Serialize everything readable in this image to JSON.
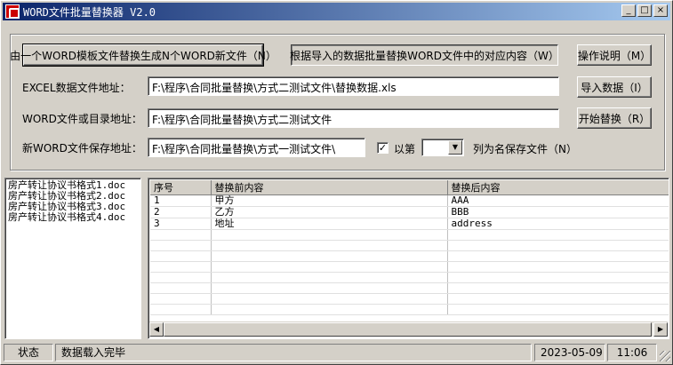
{
  "window": {
    "title": "WORD文件批量替换器 V2.0",
    "min": "_",
    "max": "□",
    "close": "×"
  },
  "buttons": {
    "template_mode": "由一个WORD模板文件替换生成N个WORD新文件（N）",
    "batch_mode": "根据导入的数据批量替换WORD文件中的对应内容（W）",
    "help": "操作说明（M）",
    "import": "导入数据（I）",
    "start": "开始替换（R）"
  },
  "form": {
    "excel_label": "EXCEL数据文件地址：",
    "excel_value": "F:\\程序\\合同批量替换\\方式二测试文件\\替换数据.xls",
    "word_label": "WORD文件或目录地址：",
    "word_value": "F:\\程序\\合同批量替换\\方式二测试文件",
    "save_label": "新WORD文件保存地址：",
    "save_value": "F:\\程序\\合同批量替换\\方式一测试文件\\",
    "checkbox_label": "以第",
    "checkbox_checked": true,
    "column_value": "",
    "column_suffix": "列为名保存文件（N）"
  },
  "files": [
    "房产转让协议书格式1.doc",
    "房产转让协议书格式2.doc",
    "房产转让协议书格式3.doc",
    "房产转让协议书格式4.doc"
  ],
  "grid": {
    "columns": [
      "序号",
      "替换前内容",
      "替换后内容"
    ],
    "rows": [
      [
        "1",
        "甲方",
        "AAA"
      ],
      [
        "2",
        "乙方",
        "BBB"
      ],
      [
        "3",
        "地址",
        "address"
      ]
    ]
  },
  "status": {
    "label": "状态",
    "message": "数据载入完毕",
    "date": "2023-05-09",
    "time": "11:06"
  }
}
